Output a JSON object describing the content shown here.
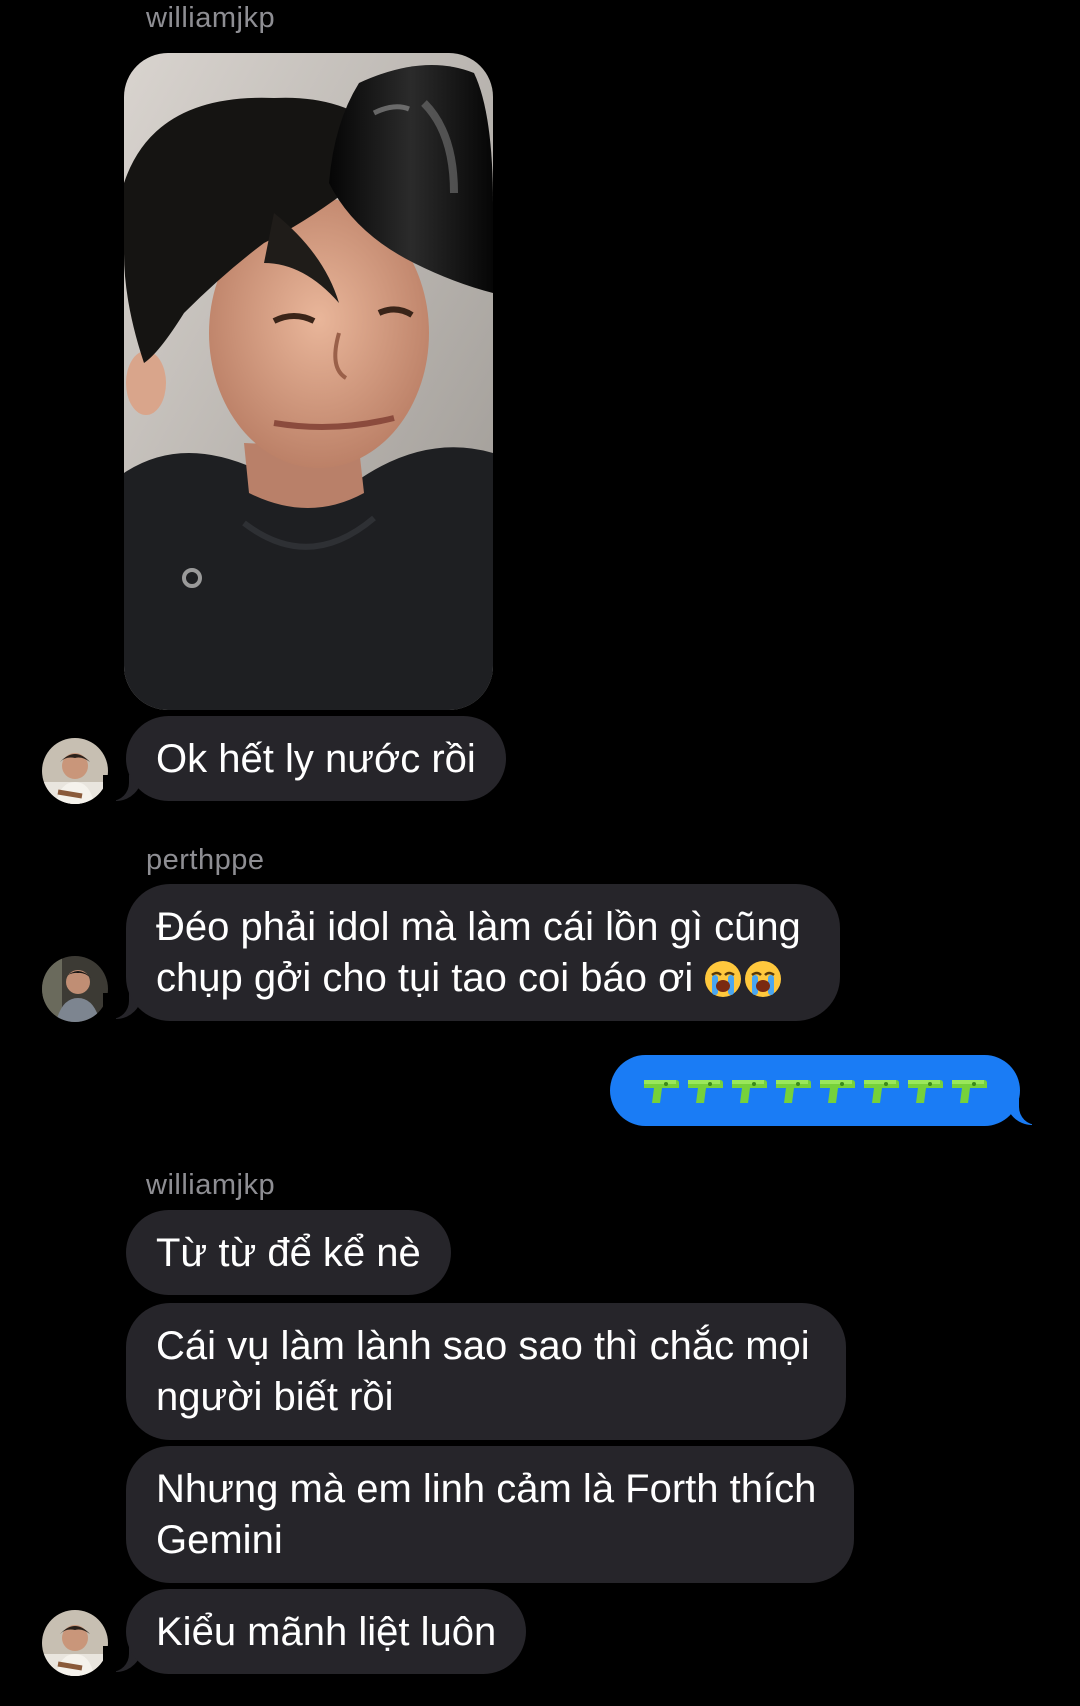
{
  "thread": {
    "messages": [
      {
        "sender": "williamjkp",
        "photo_alt": ""
      },
      {
        "text": "Ok hết ly nước rồi"
      },
      {
        "sender": "perthppe",
        "text_line1": "Đéo phải idol mà làm cái lồn gì cũng",
        "text_line2": "chụp gởi cho tụi tao coi báo ơi"
      },
      {
        "outgoing_emoji": "water-pistol x8"
      },
      {
        "sender": "williamjkp",
        "text": "Từ từ để kể nè"
      },
      {
        "text_line1": "Cái vụ làm lành sao sao thì chắc mọi",
        "text_line2": "người biết rồi"
      },
      {
        "text_line1": "Nhưng mà em linh cảm là Forth thích",
        "text_line2": "Gemini"
      },
      {
        "text": "Kiểu mãnh liệt luôn"
      }
    ]
  },
  "colors": {
    "background": "#000000",
    "incoming_bubble": "#26252a",
    "outgoing_bubble": "#1a7cf5",
    "sender_name": "#8e8e93"
  },
  "icons": {
    "crying": "loudly-crying-face-emoji",
    "pistol": "water-pistol-emoji",
    "outgoing_count": 8
  }
}
